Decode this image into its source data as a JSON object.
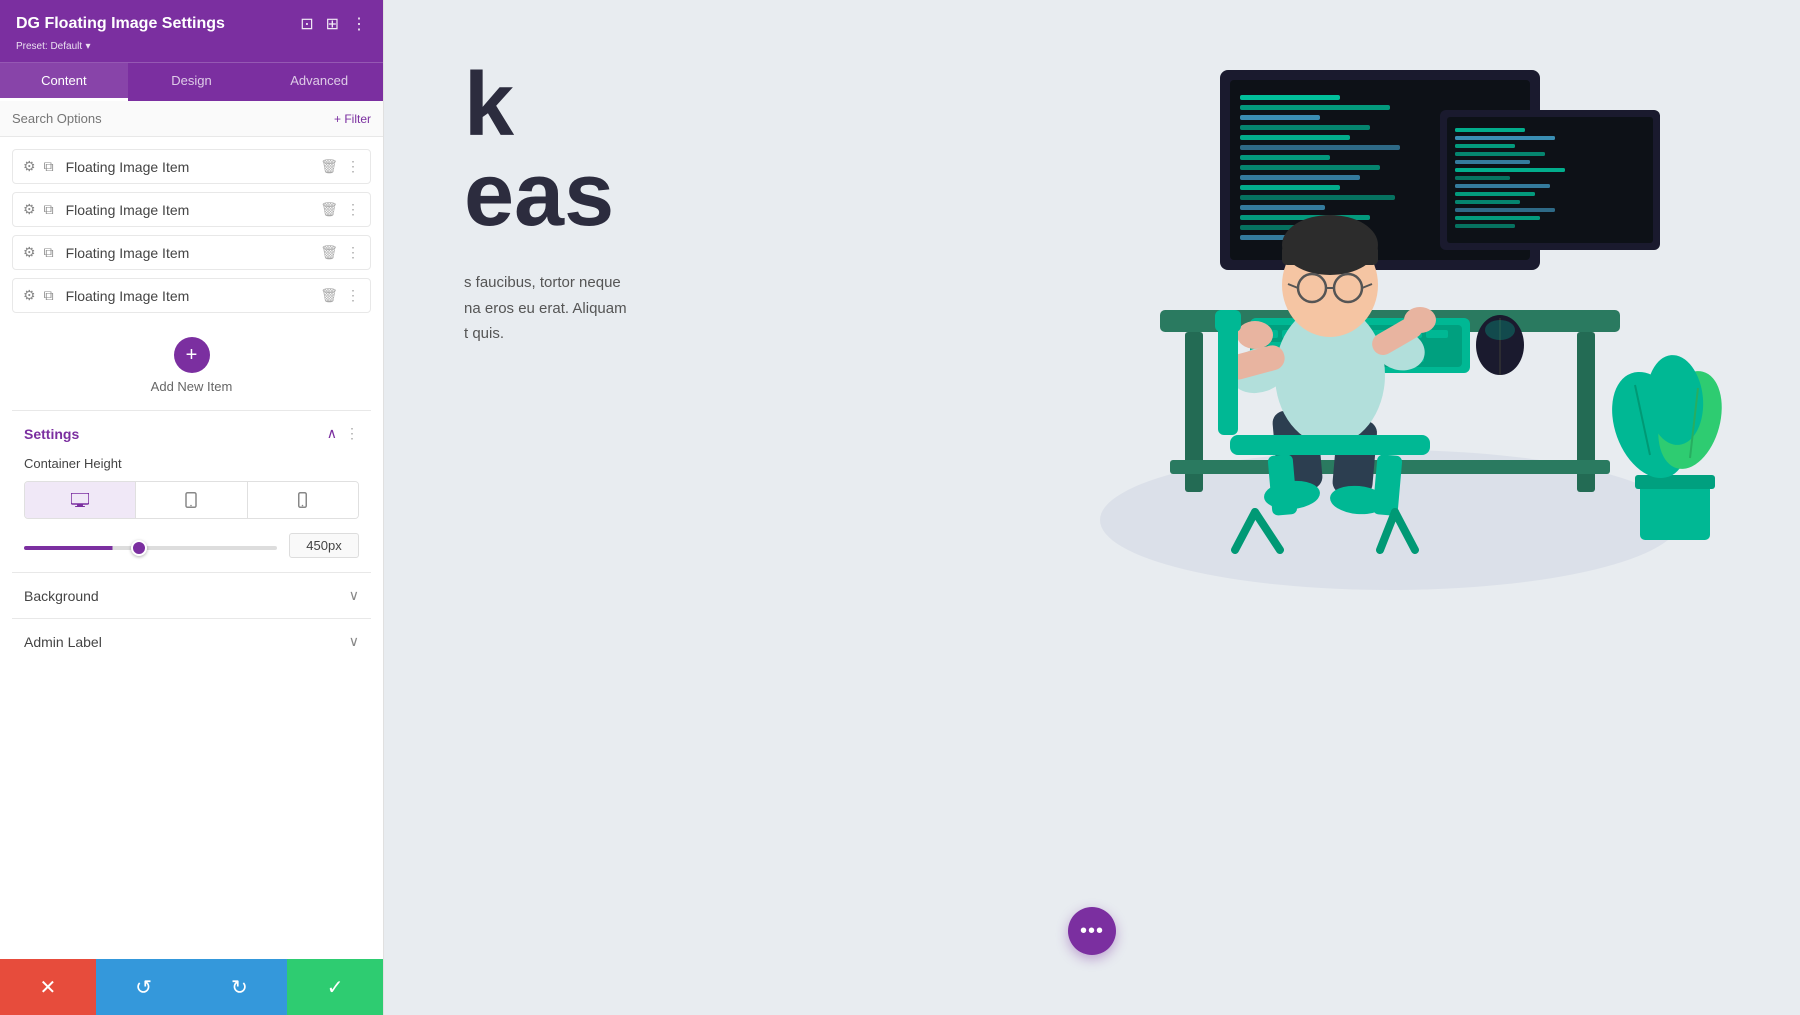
{
  "panel": {
    "title": "DG Floating Image Settings",
    "preset": "Preset: Default",
    "preset_arrow": "▾",
    "tabs": [
      {
        "id": "content",
        "label": "Content",
        "active": true
      },
      {
        "id": "design",
        "label": "Design",
        "active": false
      },
      {
        "id": "advanced",
        "label": "Advanced",
        "active": false
      }
    ],
    "search_placeholder": "Search Options",
    "filter_label": "+ Filter",
    "list_items": [
      {
        "label": "Floating Image Item"
      },
      {
        "label": "Floating Image Item"
      },
      {
        "label": "Floating Image Item"
      },
      {
        "label": "Floating Image Item"
      }
    ],
    "add_new_label": "Add New Item",
    "settings": {
      "title": "Settings",
      "container_height_label": "Container Height",
      "slider_value": "450px"
    },
    "background": {
      "title": "Background"
    },
    "admin_label": {
      "title": "Admin Label"
    }
  },
  "toolbar": {
    "cancel_icon": "✕",
    "undo_icon": "↺",
    "redo_icon": "↻",
    "save_icon": "✓"
  },
  "page": {
    "heading_line1": "k",
    "heading_line2": "eas",
    "body_text": "s faucibus, tortor neque\nna eros eu erat. Aliquam\nt quis."
  },
  "fab": {
    "label": "•••"
  }
}
